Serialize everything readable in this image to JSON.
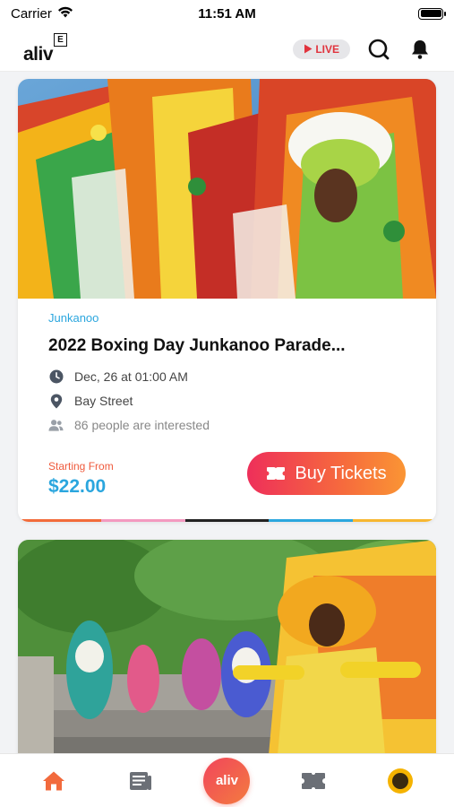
{
  "status_bar": {
    "carrier": "Carrier",
    "time": "11:51 AM"
  },
  "header": {
    "logo_text": "aliv",
    "logo_badge": "E",
    "live_label": "LIVE"
  },
  "events": [
    {
      "category": "Junkanoo",
      "title": "2022 Boxing Day Junkanoo Parade...",
      "date": "Dec, 26 at 01:00 AM",
      "location": "Bay Street",
      "interested": "86 people are interested",
      "price_label": "Starting From",
      "price": "$22.00",
      "buy_label": "Buy Tickets"
    }
  ],
  "stripe_colors": [
    "#f26b3a",
    "#f39ac0",
    "#222222",
    "#2ba6de",
    "#f7b731"
  ],
  "tab_bar": {
    "center_label": "aliv"
  },
  "colors": {
    "accent_blue": "#2ba6de",
    "accent_orange": "#ef5a3c",
    "live_red": "#e1343e"
  }
}
